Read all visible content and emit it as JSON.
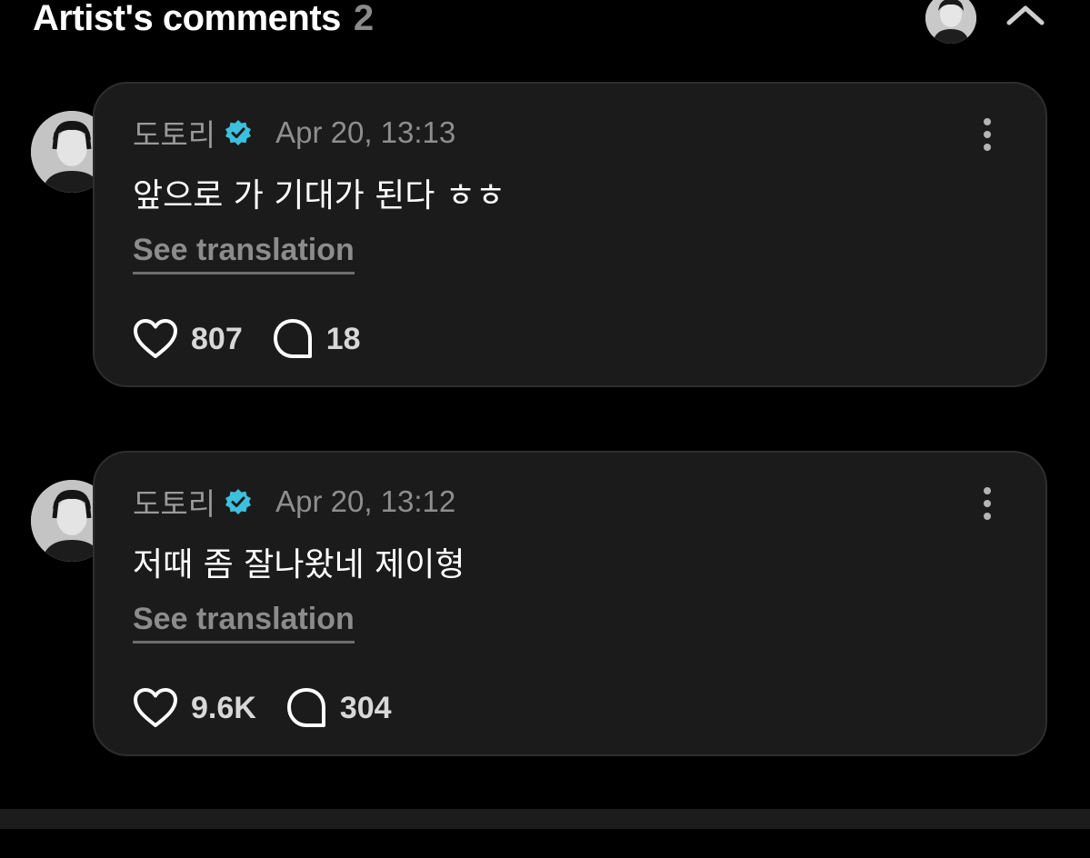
{
  "header": {
    "title": "Artist's comments",
    "count": "2"
  },
  "comments": [
    {
      "author": "도토리",
      "date": "Apr 20, 13:13",
      "text": "앞으로 가 기대가 된다 ㅎㅎ",
      "translate_label": "See translation",
      "likes": "807",
      "replies": "18"
    },
    {
      "author": "도토리",
      "date": "Apr 20, 13:12",
      "text": "저때 좀 잘나왔네 제이형",
      "translate_label": "See translation",
      "likes": "9.6K",
      "replies": "304"
    }
  ],
  "icons": {
    "verified": "verified-badge-icon",
    "like": "heart-icon",
    "reply": "speech-bubble-icon",
    "more": "more-vertical-icon",
    "collapse": "chevron-up-icon"
  },
  "colors": {
    "background": "#000000",
    "card": "#1b1b1b",
    "verified": "#3cc0dd",
    "muted_text": "#8e8e8e"
  }
}
